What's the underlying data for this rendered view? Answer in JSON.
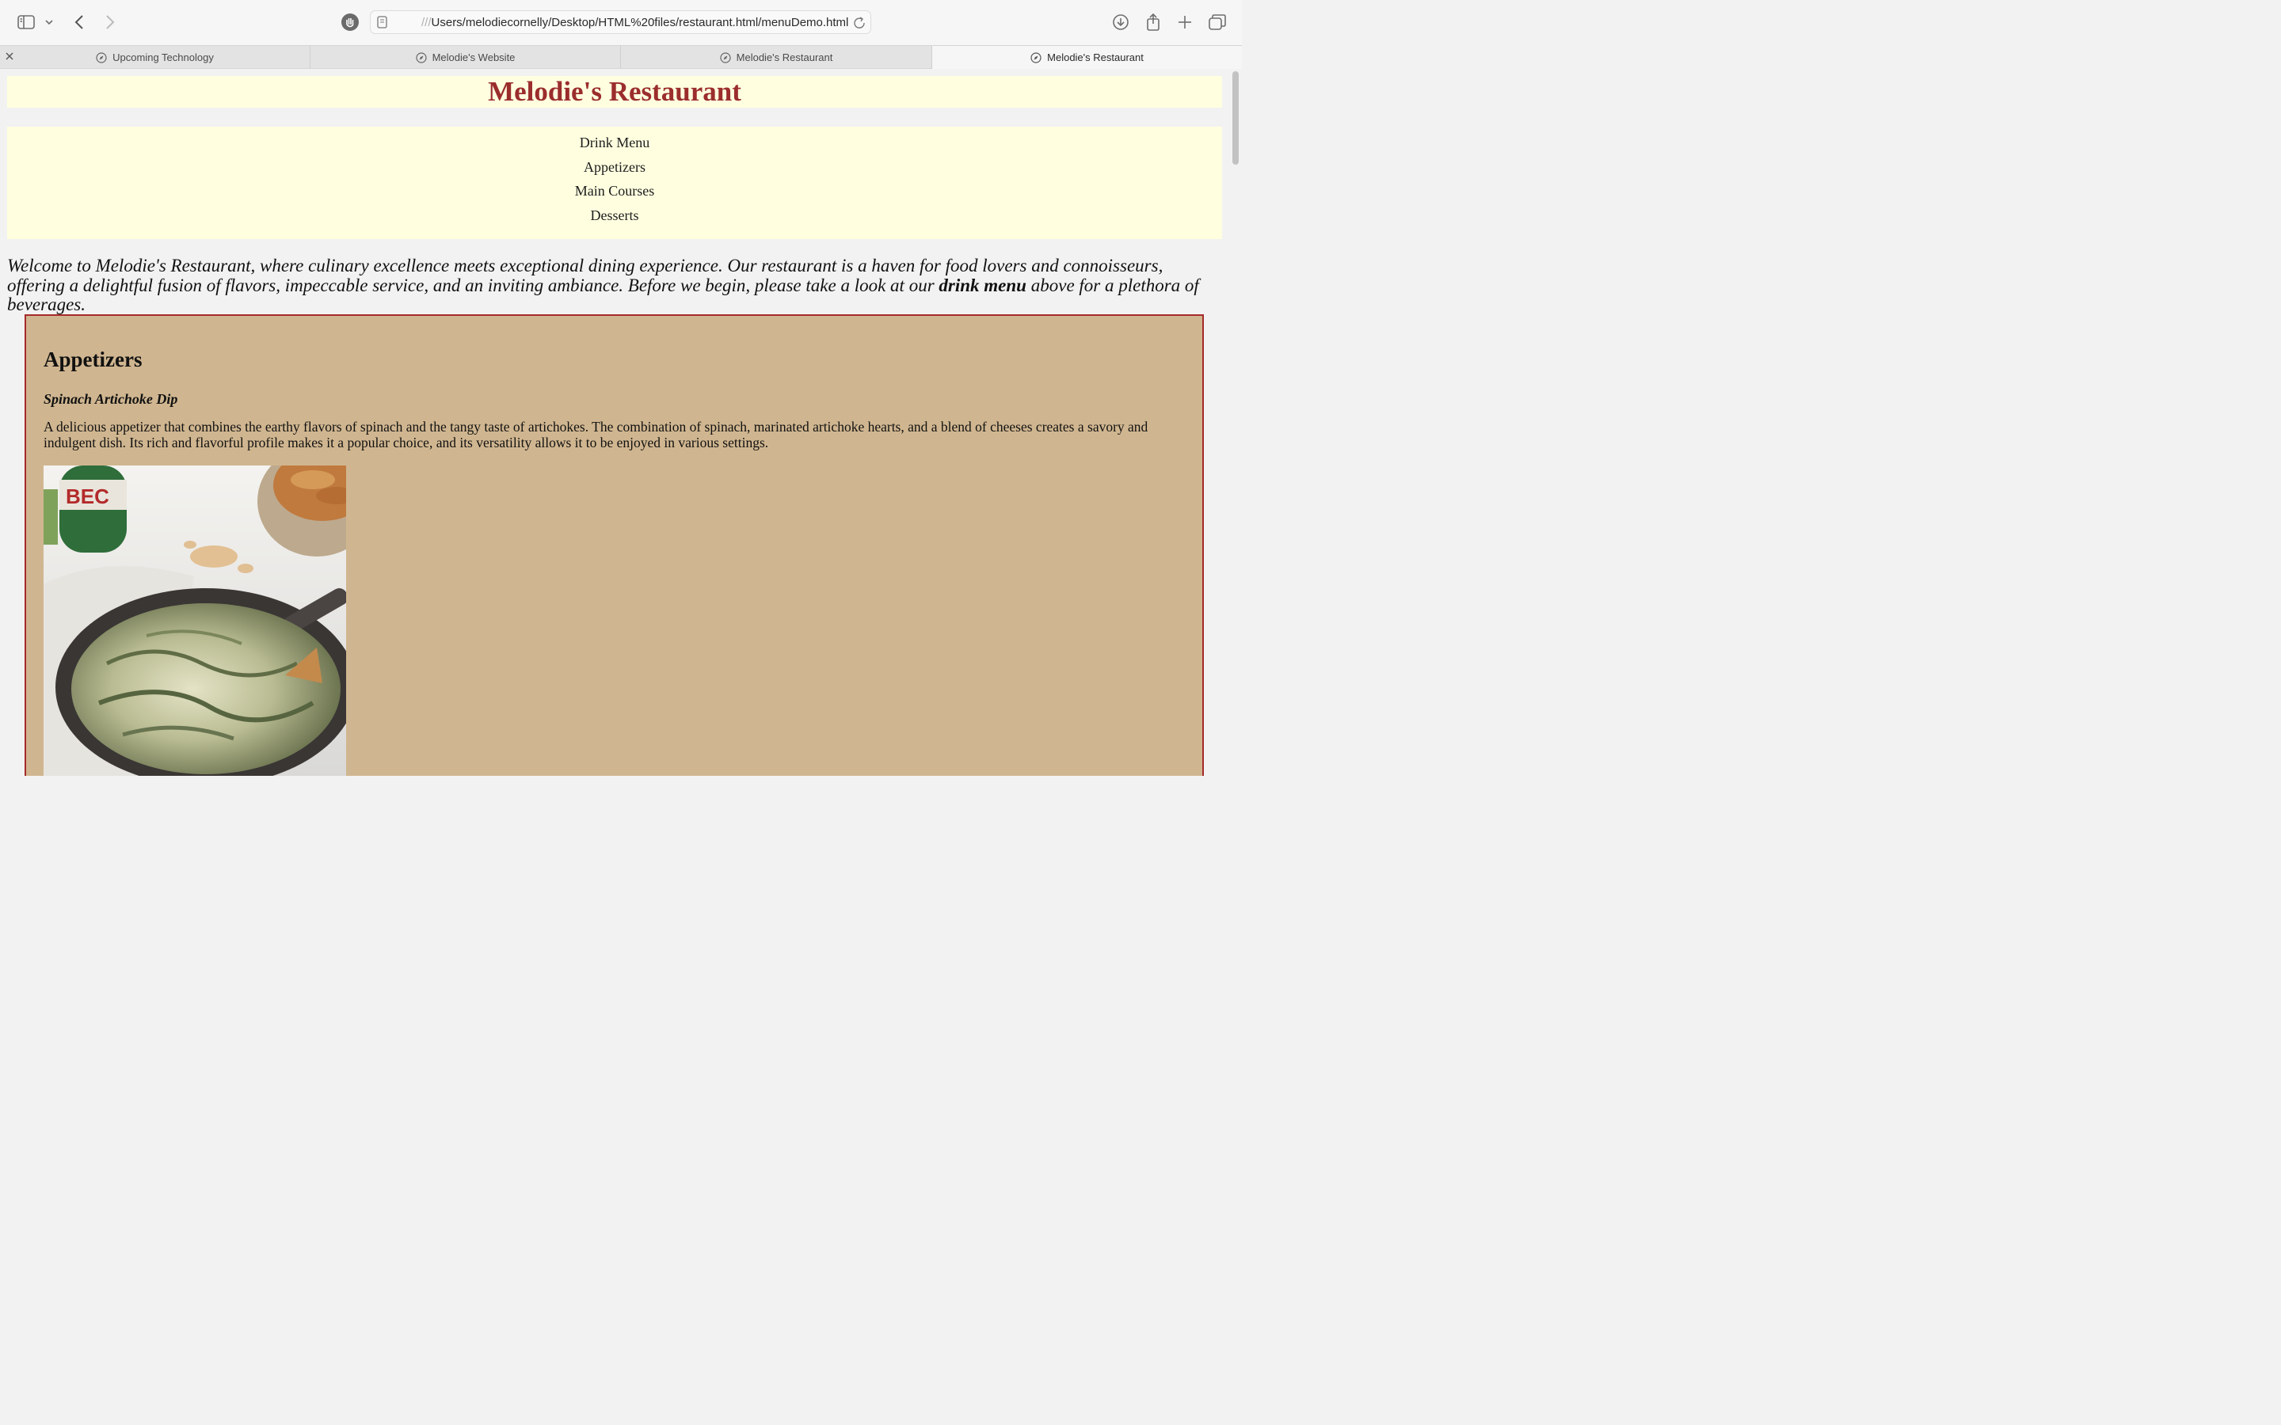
{
  "browser": {
    "url_prefix": "///",
    "url_path": "Users/melodiecornelly/Desktop/HTML%20files/restaurant.html/menuDemo.html",
    "tabs": [
      {
        "title": "Upcoming Technology",
        "active": false
      },
      {
        "title": "Melodie's Website",
        "active": false
      },
      {
        "title": "Melodie's Restaurant",
        "active": false
      },
      {
        "title": "Melodie's Restaurant",
        "active": true
      }
    ],
    "icons": [
      "sidebar-icon",
      "chevron-down-icon",
      "back-icon",
      "forward-icon",
      "privacy-shield-icon",
      "reader-icon",
      "reload-icon",
      "download-icon",
      "share-icon",
      "new-tab-icon",
      "tab-overview-icon",
      "close-icon",
      "compass-icon"
    ]
  },
  "page": {
    "title": "Melodie's Restaurant",
    "nav": [
      "Drink Menu",
      "Appetizers",
      "Main Courses",
      "Desserts"
    ],
    "welcome_before": "Welcome to Melodie's Restaurant, where culinary excellence meets exceptional dining experience. Our restaurant is a haven for food lovers and connoisseurs, offering a delightful fusion of flavors, impeccable service, and an inviting ambiance. Before we begin, please take a look at our ",
    "welcome_bold": "drink menu",
    "welcome_after": " above for a plethora of beverages.",
    "section": {
      "heading": "Appetizers",
      "item_name": "Spinach Artichoke Dip",
      "item_description": "A delicious appetizer that combines the earthy flavors of spinach and the tangy taste of artichokes. The combination of spinach, marinated artichoke hearts, and a blend of cheeses creates a savory and indulgent dish. Its rich and flavorful profile makes it a popular choice, and its versatility allows it to be enjoyed in various settings."
    }
  },
  "colors": {
    "title_red": "#9b2d2d",
    "panel_yellow": "#ffffe0",
    "menu_tan": "#d0b690",
    "menu_border": "#a52a2a"
  }
}
